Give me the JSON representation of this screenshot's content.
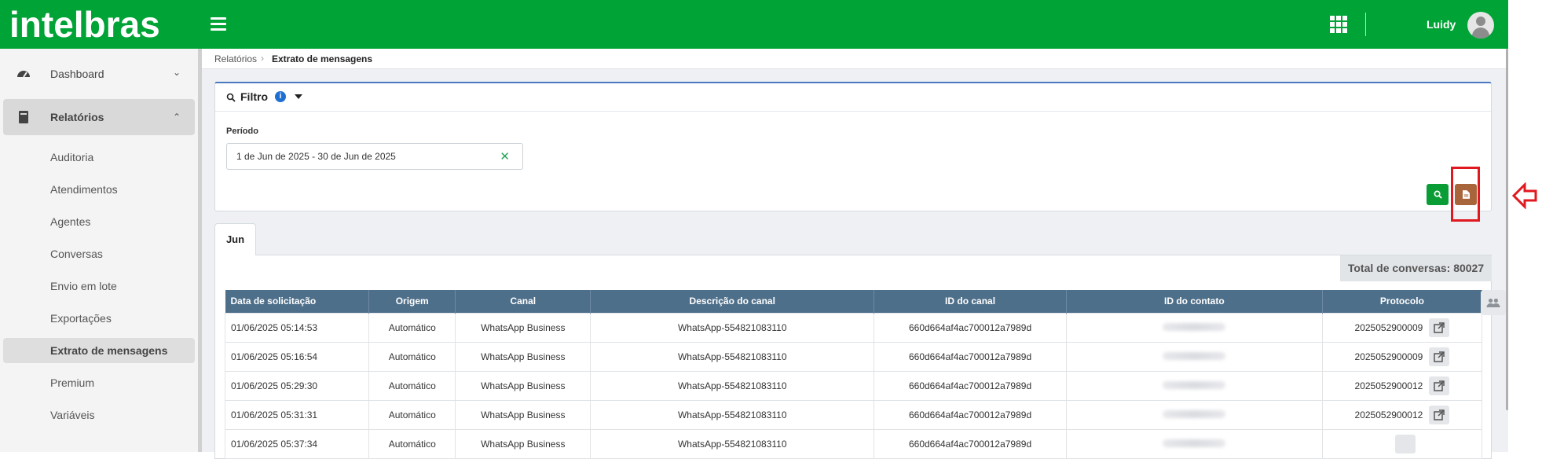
{
  "header": {
    "logo": "intelbras",
    "user_name": "Luidy",
    "icons": [
      "menu-icon",
      "apps-grid-icon",
      "user-avatar"
    ]
  },
  "sidebar": {
    "items": [
      {
        "label": "Dashboard",
        "icon": "dashboard-icon",
        "expanded": false
      },
      {
        "label": "Relatórios",
        "icon": "book-icon",
        "expanded": true
      }
    ],
    "subitems": [
      "Auditoria",
      "Atendimentos",
      "Agentes",
      "Conversas",
      "Envio em lote",
      "Exportações",
      "Extrato de mensagens",
      "Premium",
      "Variáveis"
    ],
    "selected": "Extrato de mensagens"
  },
  "breadcrumb": {
    "parent": "Relatórios",
    "current": "Extrato de mensagens"
  },
  "filter": {
    "title": "Filtro",
    "info_glyph": "i",
    "period_label": "Período",
    "period_value": "1 de Jun de 2025 - 30 de Jun de 2025"
  },
  "tabs": {
    "active": "Jun"
  },
  "summary": {
    "total_label": "Total de conversas: 80027"
  },
  "table": {
    "columns": [
      "Data de solicitação",
      "Origem",
      "Canal",
      "Descrição do canal",
      "ID do canal",
      "ID do contato",
      "Protocolo"
    ],
    "rows": [
      {
        "date": "01/06/2025 05:14:53",
        "origin": "Automático",
        "channel": "WhatsApp Business",
        "channel_desc": "WhatsApp-554821083110",
        "channel_id": "660d664af4ac700012a7989d",
        "protocol": "2025052900009"
      },
      {
        "date": "01/06/2025 05:16:54",
        "origin": "Automático",
        "channel": "WhatsApp Business",
        "channel_desc": "WhatsApp-554821083110",
        "channel_id": "660d664af4ac700012a7989d",
        "protocol": "2025052900009"
      },
      {
        "date": "01/06/2025 05:29:30",
        "origin": "Automático",
        "channel": "WhatsApp Business",
        "channel_desc": "WhatsApp-554821083110",
        "channel_id": "660d664af4ac700012a7989d",
        "protocol": "2025052900012"
      },
      {
        "date": "01/06/2025 05:31:31",
        "origin": "Automático",
        "channel": "WhatsApp Business",
        "channel_desc": "WhatsApp-554821083110",
        "channel_id": "660d664af4ac700012a7989d",
        "protocol": "2025052900012"
      },
      {
        "date": "01/06/2025 05:37:34",
        "origin": "Automático",
        "channel": "WhatsApp Business",
        "channel_desc": "WhatsApp-554821083110",
        "channel_id": "660d664af4ac700012a7989d",
        "protocol": ""
      }
    ]
  },
  "colors": {
    "brand_green": "#00a335",
    "export_button": "#a8643a",
    "table_header": "#4e6f8a",
    "highlight_red": "#e0181f"
  }
}
